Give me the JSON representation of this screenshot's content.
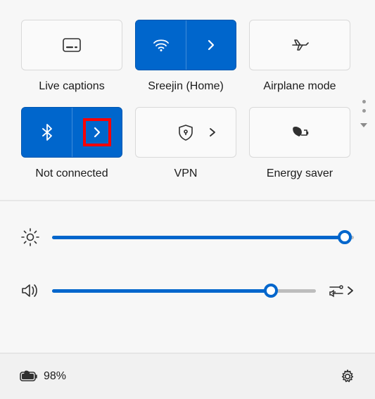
{
  "accent": "#0066cc",
  "tiles": {
    "live_captions": {
      "label": "Live captions"
    },
    "wifi": {
      "label": "Sreejin (Home)"
    },
    "airplane": {
      "label": "Airplane mode"
    },
    "bluetooth": {
      "label": "Not connected"
    },
    "vpn": {
      "label": "VPN"
    },
    "energy": {
      "label": "Energy saver"
    }
  },
  "sliders": {
    "brightness": {
      "percent": 97
    },
    "volume": {
      "percent": 83
    }
  },
  "battery": {
    "text": "98%"
  }
}
